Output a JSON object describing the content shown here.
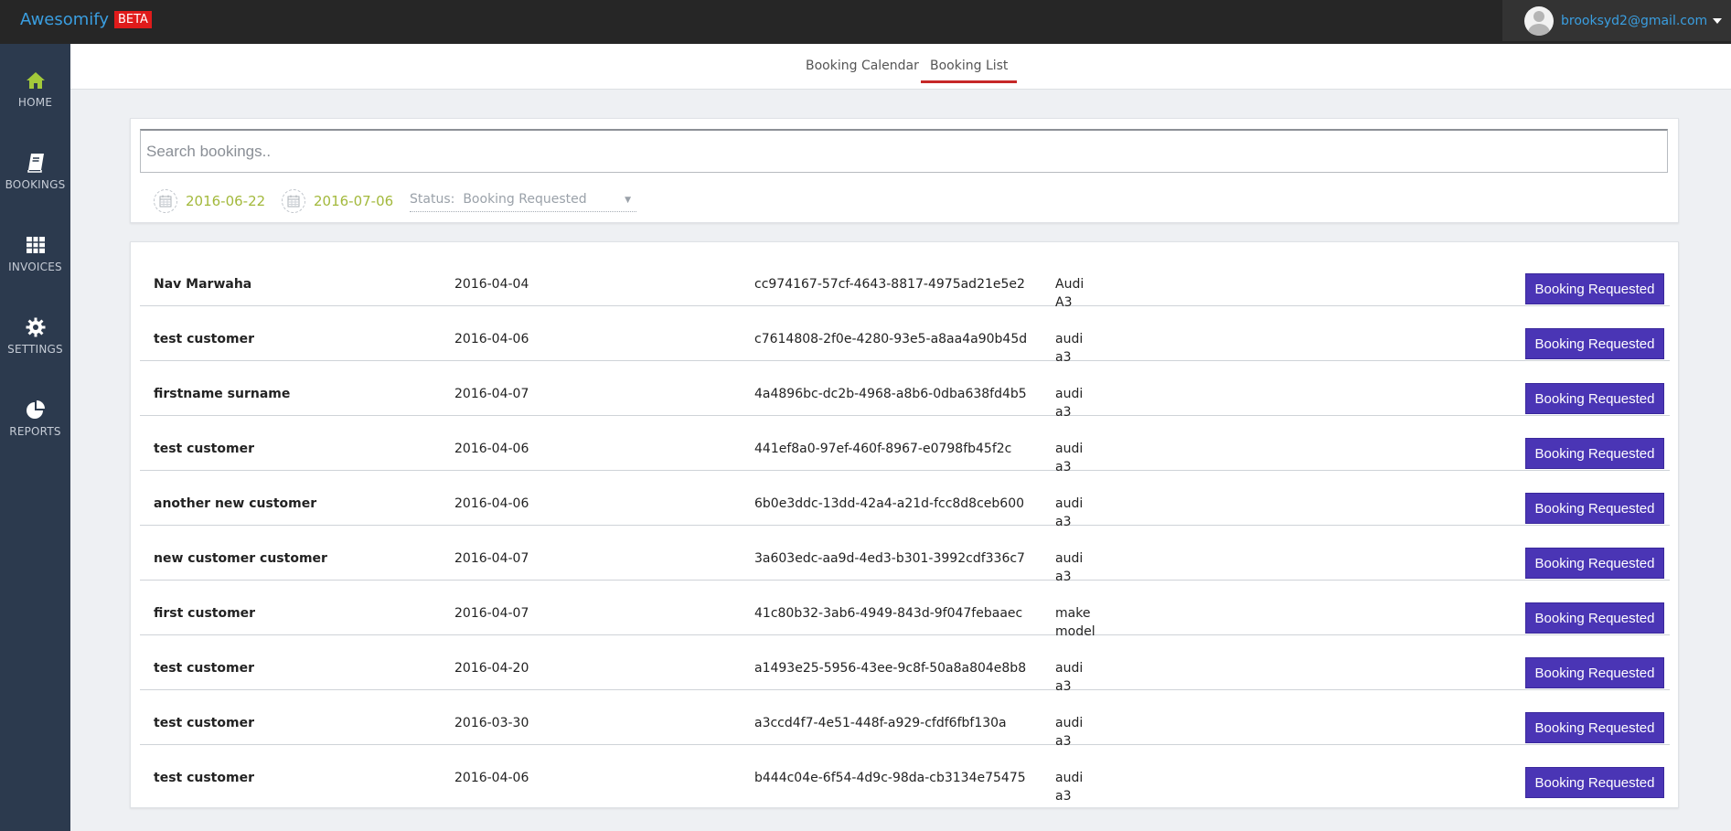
{
  "app": {
    "name": "Awesomify",
    "badge": "BETA"
  },
  "user": {
    "email": "brooksyd2@gmail.com"
  },
  "sidebar": {
    "items": [
      {
        "label": "HOME",
        "icon": "home-icon"
      },
      {
        "label": "BOOKINGS",
        "icon": "book-icon"
      },
      {
        "label": "INVOICES",
        "icon": "table-icon"
      },
      {
        "label": "SETTINGS",
        "icon": "gear-icon"
      },
      {
        "label": "REPORTS",
        "icon": "pie-chart-icon"
      }
    ]
  },
  "tabs": [
    {
      "label": "Booking Calendar",
      "active": false
    },
    {
      "label": "Booking List",
      "active": true
    }
  ],
  "filters": {
    "search_placeholder": "Search bookings..",
    "start_date": "2016-06-22",
    "end_date": "2016-07-06",
    "status_label": "Status:",
    "status_value": "Booking Requested"
  },
  "bookings": [
    {
      "name": "Nav Marwaha",
      "date": "2016-04-04",
      "id": "cc974167-57cf-4643-8817-4975ad21e5e2",
      "make": "Audi",
      "model": "A3",
      "status": "Booking Requested"
    },
    {
      "name": "test customer",
      "date": "2016-04-06",
      "id": "c7614808-2f0e-4280-93e5-a8aa4a90b45d",
      "make": "audi",
      "model": "a3",
      "status": "Booking Requested"
    },
    {
      "name": "firstname surname",
      "date": "2016-04-07",
      "id": "4a4896bc-dc2b-4968-a8b6-0dba638fd4b5",
      "make": "audi",
      "model": "a3",
      "status": "Booking Requested"
    },
    {
      "name": "test customer",
      "date": "2016-04-06",
      "id": "441ef8a0-97ef-460f-8967-e0798fb45f2c",
      "make": "audi",
      "model": "a3",
      "status": "Booking Requested"
    },
    {
      "name": "another new customer",
      "date": "2016-04-06",
      "id": "6b0e3ddc-13dd-42a4-a21d-fcc8d8ceb600",
      "make": "audi",
      "model": "a3",
      "status": "Booking Requested"
    },
    {
      "name": "new customer customer",
      "date": "2016-04-07",
      "id": "3a603edc-aa9d-4ed3-b301-3992cdf336c7",
      "make": "audi",
      "model": "a3",
      "status": "Booking Requested"
    },
    {
      "name": "first customer",
      "date": "2016-04-07",
      "id": "41c80b32-3ab6-4949-843d-9f047febaaec",
      "make": "make",
      "model": "model",
      "status": "Booking Requested"
    },
    {
      "name": "test customer",
      "date": "2016-04-20",
      "id": "a1493e25-5956-43ee-9c8f-50a8a804e8b8",
      "make": "audi",
      "model": "a3",
      "status": "Booking Requested"
    },
    {
      "name": "test customer",
      "date": "2016-03-30",
      "id": "a3ccd4f7-4e51-448f-a929-cfdf6fbf130a",
      "make": "audi",
      "model": "a3",
      "status": "Booking Requested"
    },
    {
      "name": "test customer",
      "date": "2016-04-06",
      "id": "b444c04e-6f54-4d9c-98da-cb3134e75475",
      "make": "audi",
      "model": "a3",
      "status": "Booking Requested"
    }
  ],
  "colors": {
    "topbar": "#262626",
    "sidebar": "#2c3a4e",
    "brand": "#3a9ee0",
    "beta_badge": "#e01b1b",
    "home_active": "#a3c93a",
    "date_text": "#a3b93c",
    "status_button": "#4a35b5",
    "active_tab_underline": "#c62828"
  }
}
